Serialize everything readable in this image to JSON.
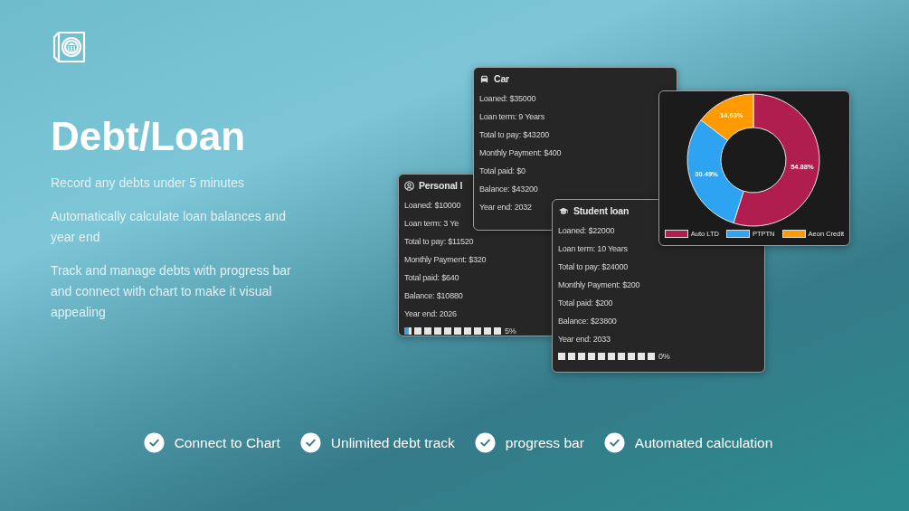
{
  "hero": {
    "title": "Debt/Loan",
    "paragraphs": [
      "Record any debts under 5 minutes",
      "Automatically calculate loan balances and year end",
      "Track and manage debts with progress bar and connect with chart to make it visual appealing"
    ]
  },
  "cards": [
    {
      "title": "Personal l",
      "lines": [
        "Loaned: $10000",
        "Loan term: 3 Ye",
        "Total to pay: $11520",
        "Monthly Payment: $320",
        "Total paid: $640",
        "Balance: $10880",
        "Year end: 2026"
      ],
      "progress": {
        "level": 0.05,
        "reading": "5%"
      }
    },
    {
      "title": "Car",
      "lines": [
        "Loaned: $35000",
        "Loan term: 9 Years",
        "Total to pay: $43200",
        "Monthly Payment: $400",
        "Total paid: $0",
        "Balance: $43200",
        "Year end: 2032"
      ]
    },
    {
      "title": "Student loan",
      "lines": [
        "Loaned: $22000",
        "Loan term: 10 Years",
        "Total to pay: $24000",
        "Monthly Payment: $200",
        "Total paid: $200",
        "Balance: $23800",
        "Year end: 2033"
      ],
      "progress": {
        "level": 0,
        "reading": "0%"
      }
    }
  ],
  "chart": {
    "chart_data": {
      "type": "donut",
      "categories": [
        "Auto LTD",
        "PTPTN",
        "Aeon Credit"
      ],
      "series": [
        {
          "colors": [
            "#b01e50",
            "#2ea3f2",
            "#ff9a00"
          ],
          "values": [
            54.88,
            30.49,
            14.63
          ]
        }
      ],
      "value_labels": [
        "54.88%",
        "30.49%",
        "14.63%"
      ],
      "legend": "bottom"
    }
  },
  "features": [
    "Connect to Chart",
    "Unlimited debt track",
    "progress bar",
    "Automated calculation"
  ]
}
